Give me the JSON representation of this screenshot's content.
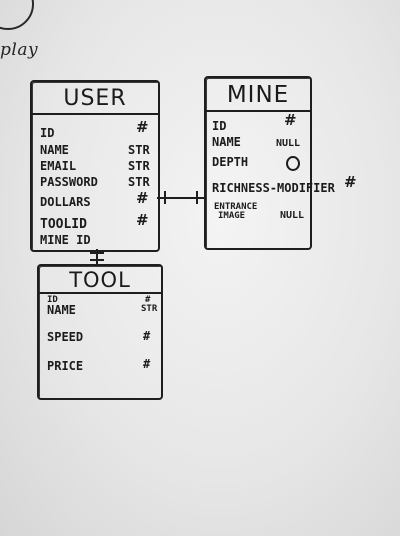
{
  "scribble": {
    "text": "play"
  },
  "entities": {
    "user": {
      "title": "USER",
      "rows": [
        {
          "name": "ID",
          "type": "#"
        },
        {
          "name": "NAME",
          "type": "STR"
        },
        {
          "name": "EMAIL",
          "type": "STR"
        },
        {
          "name": "PASSWORD",
          "type": "STR"
        },
        {
          "name": "DOLLARS",
          "type": "#"
        },
        {
          "name": "TOOLID",
          "type": "#"
        },
        {
          "name": "MINE ID",
          "type": ""
        }
      ]
    },
    "mine": {
      "title": "MINE",
      "rows": [
        {
          "name": "ID",
          "type": "#"
        },
        {
          "name": "NAME",
          "type": "NULL"
        },
        {
          "name": "DEPTH",
          "type": "O"
        },
        {
          "name": "RICHNESS-MODIFIER",
          "type": "#"
        },
        {
          "name": "ENTRANCE",
          "type": ""
        },
        {
          "name": "IMAGE",
          "type": "NULL"
        }
      ]
    },
    "tool": {
      "title": "TOOL",
      "rows": [
        {
          "name": "ID",
          "type": "#"
        },
        {
          "name": "NAME",
          "type": "STR"
        },
        {
          "name": "SPEED",
          "type": "#"
        },
        {
          "name": "PRICE",
          "type": "#"
        }
      ]
    }
  }
}
